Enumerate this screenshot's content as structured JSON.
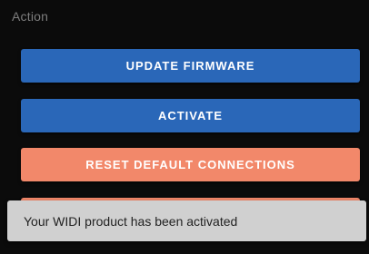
{
  "section": {
    "label": "Action"
  },
  "buttons": {
    "update_firmware": "UPDATE FIRMWARE",
    "activate": "ACTIVATE",
    "reset_default_connections": "RESET DEFAULT CONNECTIONS"
  },
  "toast": {
    "message": "Your WIDI product has been activated"
  },
  "colors": {
    "background": "#0b0b0b",
    "primary_blue": "#2a67b8",
    "accent_orange": "#f2886a",
    "toast_background": "#d0d0d0"
  }
}
